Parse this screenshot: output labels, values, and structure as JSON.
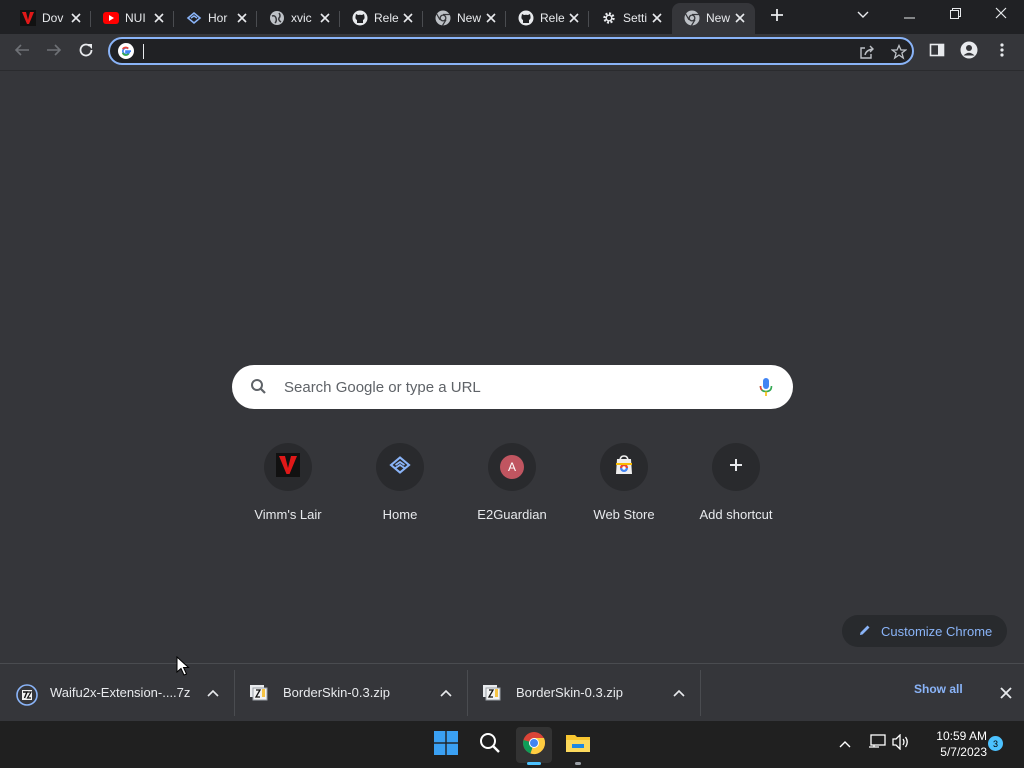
{
  "tabs": [
    {
      "title": "Dov",
      "icon": "vimm-icon",
      "active": false
    },
    {
      "title": "NUI",
      "icon": "youtube-icon",
      "active": false
    },
    {
      "title": "Hor",
      "icon": "home-logo-icon",
      "active": false
    },
    {
      "title": "xvic",
      "icon": "globe-icon",
      "active": false
    },
    {
      "title": "Rele",
      "icon": "github-icon",
      "active": false
    },
    {
      "title": "New",
      "icon": "chrome-icon",
      "active": false
    },
    {
      "title": "Rele",
      "icon": "github-icon",
      "active": false
    },
    {
      "title": "Setti",
      "icon": "settings-gear-icon",
      "active": false
    },
    {
      "title": "New",
      "icon": "chrome-icon",
      "active": true
    }
  ],
  "omnibox": {
    "value": "",
    "placeholder": ""
  },
  "search": {
    "placeholder": "Search Google or type a URL"
  },
  "shortcuts": [
    {
      "label": "Vimm's Lair",
      "icon": "vimm-icon"
    },
    {
      "label": "Home",
      "icon": "home-logo-icon"
    },
    {
      "label": "E2Guardian",
      "icon": "letter-avatar-icon",
      "letter": "A"
    },
    {
      "label": "Web Store",
      "icon": "web-store-icon"
    },
    {
      "label": "Add shortcut",
      "icon": "plus-icon"
    }
  ],
  "customize": {
    "label": "Customize Chrome"
  },
  "downloads": {
    "items": [
      {
        "name": "Waifu2x-Extension-....7z",
        "icon": "7z-file-icon"
      },
      {
        "name": "BorderSkin-0.3.zip",
        "icon": "zip-file-icon"
      },
      {
        "name": "BorderSkin-0.3.zip",
        "icon": "zip-file-icon"
      }
    ],
    "show_all": "Show all"
  },
  "taskbar": {
    "time": "10:59 AM",
    "date": "5/7/2023",
    "notifications": "3"
  },
  "colors": {
    "accent": "#8ab4f8",
    "background": "#35363a",
    "frame": "#202124"
  }
}
